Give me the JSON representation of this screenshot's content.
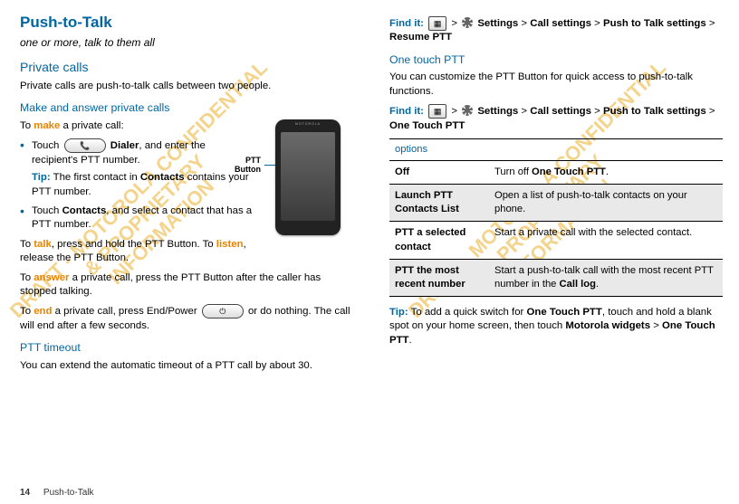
{
  "left": {
    "heading": "Push-to-Talk",
    "tagline": "one or more, talk to them all",
    "private_calls_h": "Private calls",
    "private_calls_p": "Private calls are push-to-talk calls between two people.",
    "make_answer_h": "Make and answer private calls",
    "make_intro_1": "To ",
    "make_intro_action": "make",
    "make_intro_2": " a private call:",
    "bullet1_pre": "Touch ",
    "bullet1_key": "📞",
    "bullet1_mid": " Dialer",
    "bullet1_post": ", and enter the recipient's PTT number.",
    "tip1_pre": "Tip:",
    "tip1_body_1": " The first contact in ",
    "tip1_body_contacts": "Contacts",
    "tip1_body_2": " contains your PTT number.",
    "bullet2_pre": "Touch ",
    "bullet2_contacts": "Contacts",
    "bullet2_post": ", and select a contact that has a PTT number.",
    "talk_p_1": "To ",
    "talk_action": "talk",
    "talk_p_2": ", press and hold the PTT Button. To ",
    "listen_action": "listen",
    "talk_p_3": ", release the PTT Button.",
    "answer_p_1": "To ",
    "answer_action": "answer",
    "answer_p_2": " a private call, press the PTT Button after the caller has stopped talking.",
    "end_p_1": "To ",
    "end_action": "end",
    "end_p_2": " a private call, press End/Power ",
    "end_key": "⏻",
    "end_p_3": " or do nothing. The call will end after a few seconds.",
    "ptt_timeout_h": "PTT timeout",
    "ptt_timeout_p": "You can extend the automatic timeout of a PTT call by about 30.",
    "phone_brand": "MOTOROLA",
    "ptt_button_label": "PTT Button"
  },
  "right": {
    "findit_label": "Find it:",
    "grid_icon": "▦",
    "arrow": ">",
    "settings": "Settings",
    "call_settings": "Call settings",
    "ptt_settings": "Push to Talk settings",
    "resume_ptt": "Resume PTT",
    "one_touch_h": "One touch PTT",
    "one_touch_p": "You can customize the PTT Button for quick access to push-to-talk functions.",
    "one_touch_ptt": "One Touch PTT",
    "table_header": "options",
    "rows": [
      {
        "name": "Off",
        "desc_pre": "Turn off ",
        "desc_b": "One Touch PTT",
        "desc_post": "."
      },
      {
        "name": "Launch PTT Contacts List",
        "desc_pre": "Open a list of push-to-talk contacts on your phone.",
        "desc_b": "",
        "desc_post": ""
      },
      {
        "name": "PTT a selected contact",
        "desc_pre": "Start a private call with the selected contact.",
        "desc_b": "",
        "desc_post": ""
      },
      {
        "name": "PTT the most recent number",
        "desc_pre": "Start a push-to-talk call with the most recent PTT number in the ",
        "desc_b": "Call log",
        "desc_post": "."
      }
    ],
    "tip2_pre": "Tip:",
    "tip2_1": " To add a quick switch for ",
    "tip2_b1": "One Touch PTT",
    "tip2_2": ", touch and hold a blank spot on your home screen, then touch ",
    "tip2_b2": "Motorola widgets",
    "tip2_3": " > ",
    "tip2_b3": "One Touch PTT",
    "tip2_4": "."
  },
  "footer": {
    "page": "14",
    "section": "Push-to-Talk"
  },
  "watermark": "DRAFT - MOTOROLA CONFIDENTIAL\n& PROPRIETARY\nINFORMATION"
}
